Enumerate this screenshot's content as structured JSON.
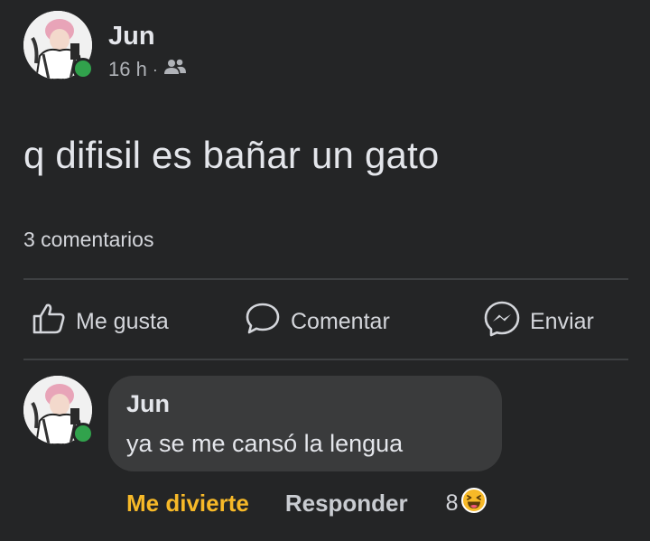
{
  "post": {
    "author": "Jun",
    "time": "16 h",
    "separator": "·",
    "audience_icon": "friends-icon",
    "text": "q difisil es bañar un gato",
    "comments_count": "3 comentarios"
  },
  "actions": {
    "like_label": "Me gusta",
    "comment_label": "Comentar",
    "send_label": "Enviar"
  },
  "comment": {
    "author": "Jun",
    "text": "ya se me cansó la lengua",
    "reaction_label": "Me divierte",
    "reply_label": "Responder",
    "reaction_count": "8",
    "reaction_icon": "haha-emoji-icon"
  },
  "colors": {
    "background": "#242526",
    "bubble": "#3a3b3c",
    "online": "#31a24c",
    "haha_reaction": "#f7b928"
  }
}
